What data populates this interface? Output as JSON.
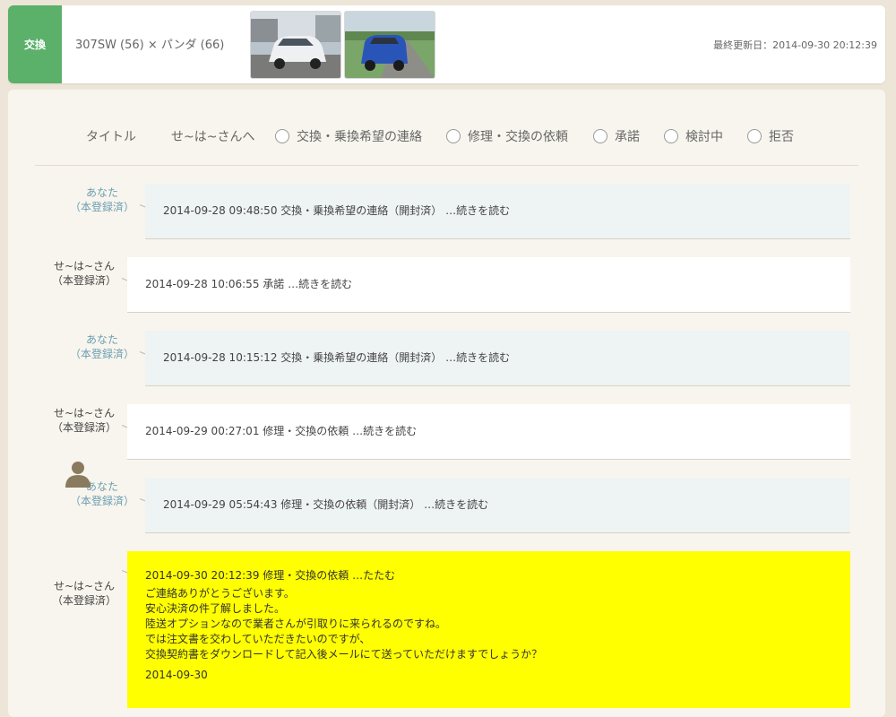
{
  "header": {
    "badge": "交換",
    "title": "307SW (56) × パンダ (66)",
    "updated": "最終更新日：2014-09-30 20:12:39"
  },
  "filters": {
    "title_label": "タイトル",
    "recipient": "せ~は~さんへ",
    "options": [
      "交換・乗換希望の連絡",
      "修理・交換の依頼",
      "承諾",
      "検討中",
      "拒否"
    ]
  },
  "senders": {
    "you_line1": "あなた",
    "other_line1": "せ~は~さん",
    "status": "（本登録済）"
  },
  "messages": [
    {
      "from": "you",
      "text": "2014-09-28 09:48:50 交換・乗換希望の連絡（開封済） …続きを読む"
    },
    {
      "from": "other",
      "text": "2014-09-28 10:06:55 承諾 …続きを読む"
    },
    {
      "from": "you",
      "text": "2014-09-28 10:15:12 交換・乗換希望の連絡（開封済） …続きを読む"
    },
    {
      "from": "other",
      "text": "2014-09-29 00:27:01 修理・交換の依頼 …続きを読む"
    },
    {
      "from": "you",
      "text": "2014-09-29 05:54:43 修理・交換の依頼（開封済） …続きを読む"
    }
  ],
  "highlight": {
    "header": "2014-09-30 20:12:39 修理・交換の依頼 …たたむ",
    "lines": [
      "ご連絡ありがとうございます。",
      "安心決済の件了解しました。",
      "陸送オプションなので業者さんが引取りに来られるのですね。",
      "では注文書を交わしていただきたいのですが、",
      "交換契約書をダウンロードして記入後メールにて送っていただけますでしょうか？"
    ],
    "date": "2014-09-30"
  }
}
